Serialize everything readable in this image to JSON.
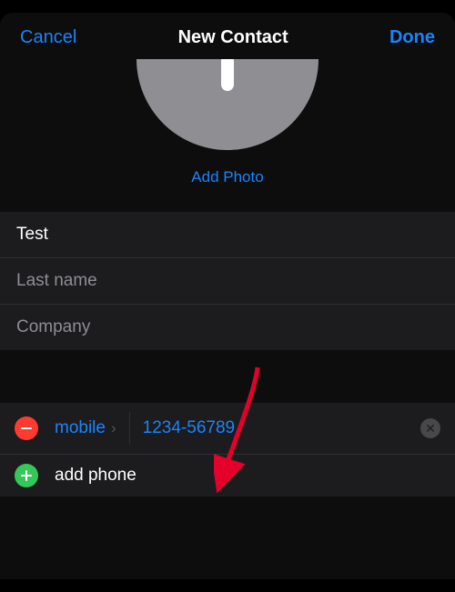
{
  "header": {
    "cancel": "Cancel",
    "title": "New Contact",
    "done": "Done"
  },
  "photo": {
    "addLabel": "Add Photo"
  },
  "nameFields": {
    "firstName": "Test",
    "lastNamePlaceholder": "Last name",
    "companyPlaceholder": "Company"
  },
  "phone": {
    "label": "mobile",
    "value": "1234-56789",
    "addLabel": "add phone"
  }
}
